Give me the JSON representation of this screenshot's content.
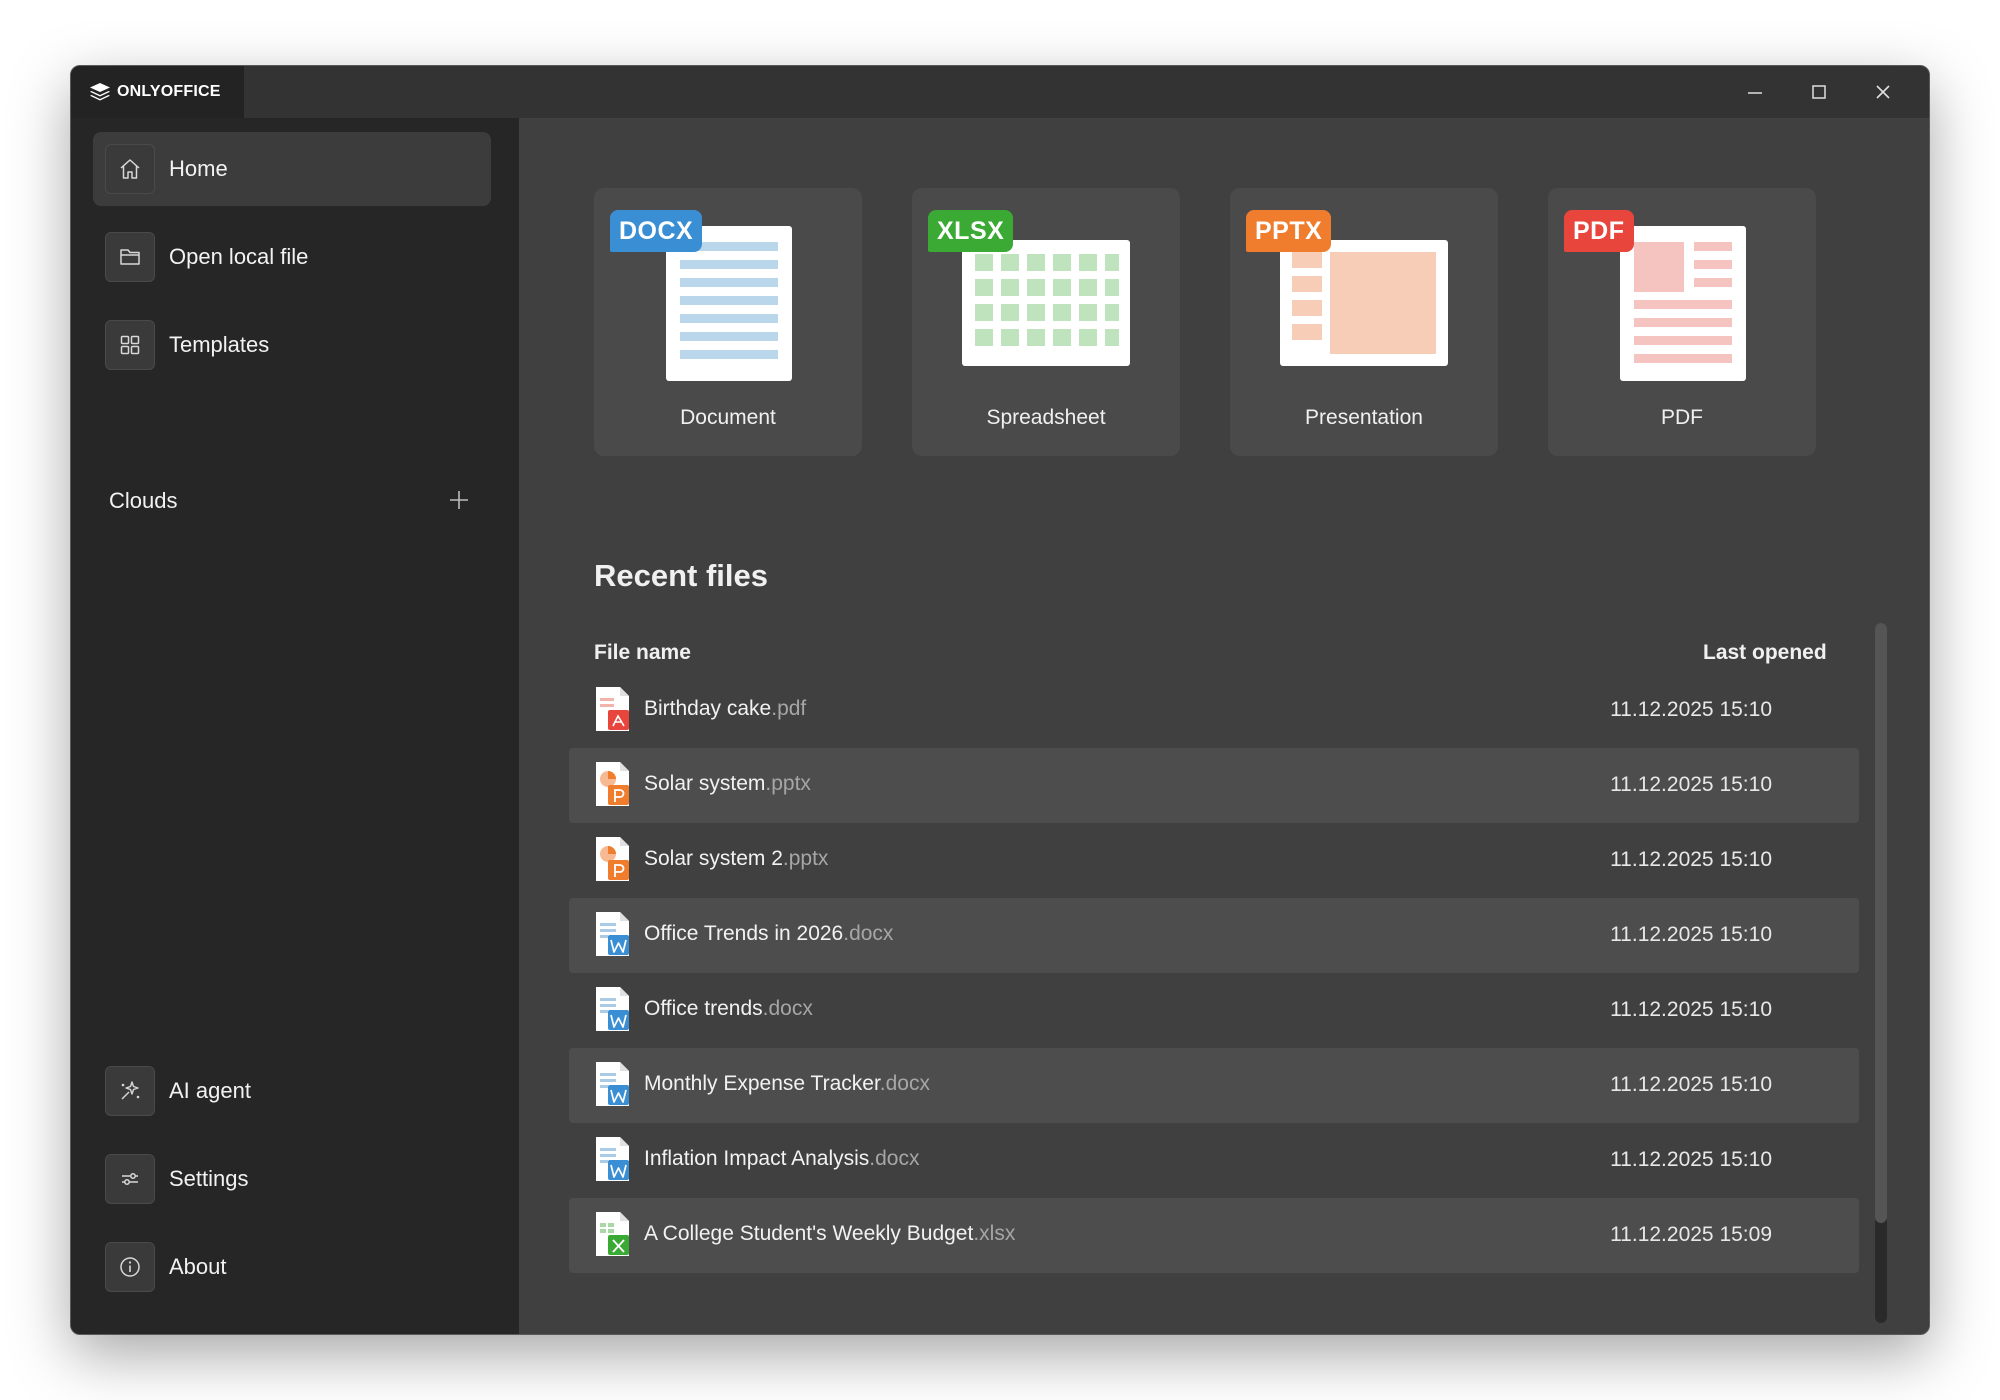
{
  "app": {
    "title": "ONLYOFFICE"
  },
  "sidebar": {
    "items": [
      {
        "label": "Home",
        "icon": "home-icon"
      },
      {
        "label": "Open local file",
        "icon": "folder-icon"
      },
      {
        "label": "Templates",
        "icon": "grid-icon"
      }
    ],
    "clouds_label": "Clouds",
    "bottom_items": [
      {
        "label": "AI agent",
        "icon": "ai-sparkle-icon"
      },
      {
        "label": "Settings",
        "icon": "sliders-icon"
      },
      {
        "label": "About",
        "icon": "info-icon"
      }
    ]
  },
  "create": {
    "cards": [
      {
        "badge": "DOCX",
        "label": "Document",
        "color": "#3a8fd4"
      },
      {
        "badge": "XLSX",
        "label": "Spreadsheet",
        "color": "#3aaa35"
      },
      {
        "badge": "PPTX",
        "label": "Presentation",
        "color": "#f07d2e"
      },
      {
        "badge": "PDF",
        "label": "PDF",
        "color": "#e8453c"
      }
    ]
  },
  "recent": {
    "title": "Recent files",
    "col_name": "File name",
    "col_date": "Last opened",
    "files": [
      {
        "name": "Birthday cake",
        "ext": ".pdf",
        "date": "11.12.2025 15:10",
        "type": "pdf"
      },
      {
        "name": "Solar system",
        "ext": ".pptx",
        "date": "11.12.2025 15:10",
        "type": "pptx"
      },
      {
        "name": "Solar system 2",
        "ext": ".pptx",
        "date": "11.12.2025 15:10",
        "type": "pptx"
      },
      {
        "name": "Office Trends in 2026",
        "ext": ".docx",
        "date": "11.12.2025 15:10",
        "type": "docx"
      },
      {
        "name": "Office trends",
        "ext": ".docx",
        "date": "11.12.2025 15:10",
        "type": "docx"
      },
      {
        "name": "Monthly Expense Tracker",
        "ext": ".docx",
        "date": "11.12.2025 15:10",
        "type": "docx"
      },
      {
        "name": "Inflation Impact Analysis",
        "ext": ".docx",
        "date": "11.12.2025 15:10",
        "type": "docx"
      },
      {
        "name": "A College Student's Weekly Budget",
        "ext": ".xlsx",
        "date": "11.12.2025 15:09",
        "type": "xlsx"
      }
    ]
  }
}
